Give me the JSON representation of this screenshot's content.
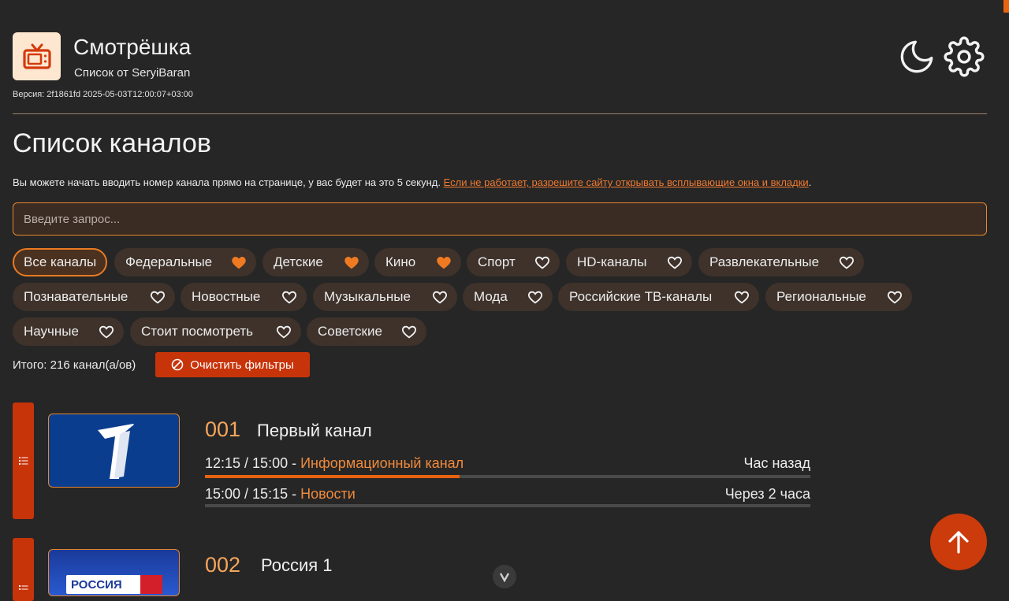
{
  "app": {
    "title": "Смотрёшка",
    "subtitle": "Список от SeryiBaran",
    "version": "Версия: 2f1861fd 2025-05-03T12:00:07+03:00",
    "icon": "tv-icon",
    "accent": "#e8630f"
  },
  "header_buttons": {
    "theme_icon": "moon-icon",
    "settings_icon": "gear-icon"
  },
  "page": {
    "title": "Список каналов",
    "hint_text": "Вы можете начать вводить номер канала прямо на странице, у вас будет на это 5 секунд. ",
    "hint_link": "Если не работает, разрешите сайту открывать всплывающие окна и вкладки",
    "hint_end": "."
  },
  "search": {
    "placeholder": "Введите запрос...",
    "value": ""
  },
  "filters": {
    "items": [
      {
        "label": "Все каналы",
        "active": true,
        "favorite": null
      },
      {
        "label": "Федеральные",
        "active": false,
        "favorite": true
      },
      {
        "label": "Детские",
        "active": false,
        "favorite": true
      },
      {
        "label": "Кино",
        "active": false,
        "favorite": true
      },
      {
        "label": "Спорт",
        "active": false,
        "favorite": false
      },
      {
        "label": "HD-каналы",
        "active": false,
        "favorite": false
      },
      {
        "label": "Развлекательные",
        "active": false,
        "favorite": false
      },
      {
        "label": "Познавательные",
        "active": false,
        "favorite": false
      },
      {
        "label": "Новостные",
        "active": false,
        "favorite": false
      },
      {
        "label": "Музыкальные",
        "active": false,
        "favorite": false
      },
      {
        "label": "Мода",
        "active": false,
        "favorite": false
      },
      {
        "label": "Российские ТВ-каналы",
        "active": false,
        "favorite": false
      },
      {
        "label": "Региональные",
        "active": false,
        "favorite": false
      },
      {
        "label": "Научные",
        "active": false,
        "favorite": false
      },
      {
        "label": "Стоит посмотреть",
        "active": false,
        "favorite": false
      },
      {
        "label": "Советские",
        "active": false,
        "favorite": false
      }
    ],
    "total": "Итого: 216 канал(а/ов)",
    "clear_label": "Очистить фильтры"
  },
  "channels": [
    {
      "number": "001",
      "name": "Первый канал",
      "programs": [
        {
          "time": "12:15 / 15:00 -",
          "title": "Информационный канал",
          "relative": "Час назад",
          "progress": 0.42
        },
        {
          "time": "15:00 / 15:15 -",
          "title": "Новости",
          "relative": "Через 2 часа",
          "progress": 0
        }
      ]
    },
    {
      "number": "002",
      "name": "Россия 1",
      "logo_text": "РОССИЯ"
    }
  ]
}
